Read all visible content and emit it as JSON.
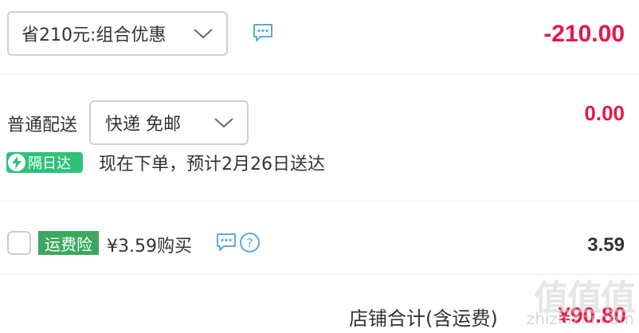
{
  "discount": {
    "select_label": "省210元:组合优惠",
    "amount": "-210.00"
  },
  "shipping": {
    "label": "普通配送",
    "select_label": "快递 免邮",
    "amount": "0.00",
    "badge": "隔日达",
    "delivery_text": "现在下单，预计2月26日送达"
  },
  "insurance": {
    "badge": "运费险",
    "price_text": "¥3.59购买",
    "amount": "3.59"
  },
  "total": {
    "label": "店铺合计(含运费)",
    "amount": "¥90.80"
  },
  "watermark": {
    "main": "值值值",
    "sub": "zhizhizhi.com"
  },
  "colors": {
    "price_red": "#e8174a",
    "icon_blue": "#5aa9e6",
    "badge_green": "#2fc27a"
  },
  "icons": [
    "chevron-down-icon",
    "chat-bubble-icon",
    "lightning-icon",
    "help-icon"
  ]
}
